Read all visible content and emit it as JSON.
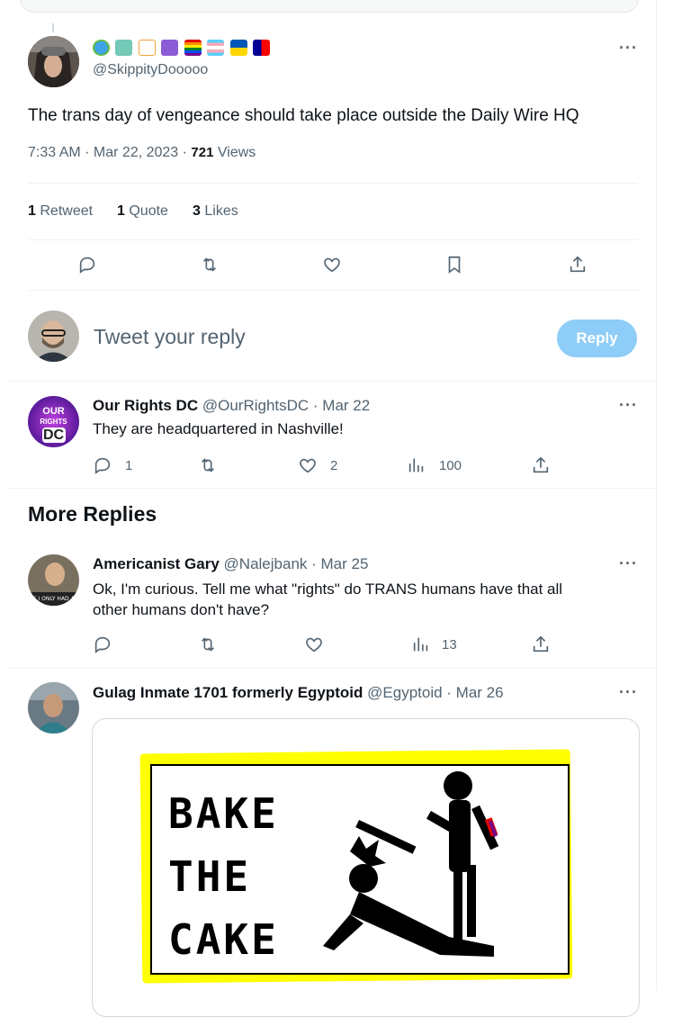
{
  "main_tweet": {
    "handle": "@SkippityDooooo",
    "text": "The trans day of vengeance should take place outside the Daily Wire HQ",
    "time": "7:33 AM · Mar 22, 2023 · ",
    "views_count": "721",
    "views_label": " Views",
    "retweets_count": "1",
    "retweets_label": "Retweet",
    "quotes_count": "1",
    "quotes_label": "Quote",
    "likes_count": "3",
    "likes_label": "Likes",
    "name_emojis": [
      "globe-icon",
      "liberty-icon",
      "scales-icon",
      "caduceus-icon",
      "rainbow-flag-icon",
      "trans-flag-icon",
      "ukraine-flag-icon",
      "taiwan-flag-icon"
    ]
  },
  "compose": {
    "placeholder": "Tweet your reply",
    "button": "Reply"
  },
  "replies": [
    {
      "name": "Our Rights DC",
      "handle": "@OurRightsDC · Mar 22",
      "text": "They are headquartered in Nashville!",
      "replies": "1",
      "retweets": "",
      "likes": "2",
      "views": "100",
      "avatar_text": [
        "OUR",
        "RIGHTS",
        "DC"
      ]
    }
  ],
  "section_title": "More Replies",
  "more_replies": [
    {
      "name": "Americanist Gary",
      "handle": "@Nalejbank · Mar 25",
      "text_line1": "Ok, I'm curious. Tell me what \"rights\" do TRANS humans have that all",
      "text_line2": "other humans don't have?",
      "replies": "",
      "retweets": "",
      "likes": "",
      "views": "13"
    },
    {
      "name": "Gulag Inmate 1701 formerly Egyptoid",
      "handle": "@Egyptoid · Mar 26",
      "image_text": [
        "BAKE",
        "THE",
        "CAKE"
      ]
    }
  ],
  "colors": {
    "accent": "#1d9bf0",
    "reply_button_disabled": "#8ecdf7",
    "image_highlight": "#ffff00"
  }
}
